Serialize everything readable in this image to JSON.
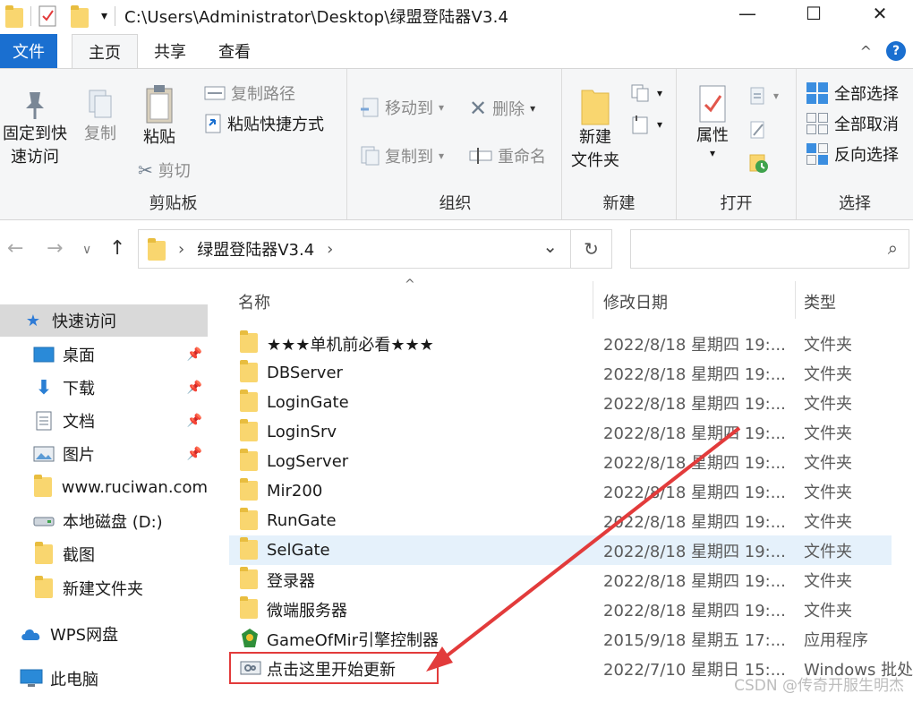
{
  "titlebar": {
    "path": "C:\\Users\\Administrator\\Desktop\\绿盟登陆器V3.4",
    "minimize": "—",
    "maximize": "☐",
    "close": "✕"
  },
  "tabs": [
    "文件",
    "主页",
    "共享",
    "查看"
  ],
  "ribbon": {
    "clipboard": {
      "group": "剪贴板",
      "pin_l1": "固定到快",
      "pin_l2": "速访问",
      "copy": "复制",
      "paste": "粘贴",
      "copy_path": "复制路径",
      "paste_shortcut": "粘贴快捷方式",
      "cut": "剪切"
    },
    "organize": {
      "group": "组织",
      "move_to": "移动到",
      "copy_to": "复制到",
      "delete": "删除",
      "rename": "重命名"
    },
    "new": {
      "group": "新建",
      "new_folder_l1": "新建",
      "new_folder_l2": "文件夹"
    },
    "open": {
      "group": "打开",
      "properties": "属性"
    },
    "select": {
      "group": "选择",
      "select_all": "全部选择",
      "select_none": "全部取消",
      "invert": "反向选择"
    }
  },
  "address": {
    "crumb": "绿盟登陆器V3.4",
    "sep": "›",
    "dropdown": "⌄",
    "refresh": "↻",
    "search_icon": "⌕"
  },
  "sidenav": {
    "quick_access": "快速访问",
    "items": [
      {
        "label": "桌面",
        "pinned": true
      },
      {
        "label": "下载",
        "pinned": true
      },
      {
        "label": "文档",
        "pinned": true
      },
      {
        "label": "图片",
        "pinned": true
      },
      {
        "label": "www.ruciwan.com",
        "pinned": false
      },
      {
        "label": "本地磁盘 (D:)",
        "pinned": false
      },
      {
        "label": "截图",
        "pinned": false
      },
      {
        "label": "新建文件夹",
        "pinned": false
      }
    ],
    "wps": "WPS网盘",
    "pc": "此电脑"
  },
  "list": {
    "col_name": "名称",
    "col_date": "修改日期",
    "col_type": "类型",
    "rows": [
      {
        "name": "★★★单机前必看★★★",
        "date": "2022/8/18 星期四 19:...",
        "type": "文件夹"
      },
      {
        "name": "DBServer",
        "date": "2022/8/18 星期四 19:...",
        "type": "文件夹"
      },
      {
        "name": "LoginGate",
        "date": "2022/8/18 星期四 19:...",
        "type": "文件夹"
      },
      {
        "name": "LoginSrv",
        "date": "2022/8/18 星期四 19:...",
        "type": "文件夹"
      },
      {
        "name": "LogServer",
        "date": "2022/8/18 星期四 19:...",
        "type": "文件夹"
      },
      {
        "name": "Mir200",
        "date": "2022/8/18 星期四 19:...",
        "type": "文件夹"
      },
      {
        "name": "RunGate",
        "date": "2022/8/18 星期四 19:...",
        "type": "文件夹"
      },
      {
        "name": "SelGate",
        "date": "2022/8/18 星期四 19:...",
        "type": "文件夹"
      },
      {
        "name": "登录器",
        "date": "2022/8/18 星期四 19:...",
        "type": "文件夹"
      },
      {
        "name": "微端服务器",
        "date": "2022/8/18 星期四 19:...",
        "type": "文件夹"
      },
      {
        "name": "GameOfMir引擎控制器",
        "date": "2015/9/18 星期五 17:...",
        "type": "应用程序"
      },
      {
        "name": "点击这里开始更新",
        "date": "2022/7/10 星期日 15:...",
        "type": "Windows 批处"
      }
    ]
  },
  "watermark": "CSDN @传奇开服生明杰",
  "colors": {
    "accent": "#1a6fd0",
    "annotation": "#e23b3b",
    "folder": "#f9d66f"
  }
}
